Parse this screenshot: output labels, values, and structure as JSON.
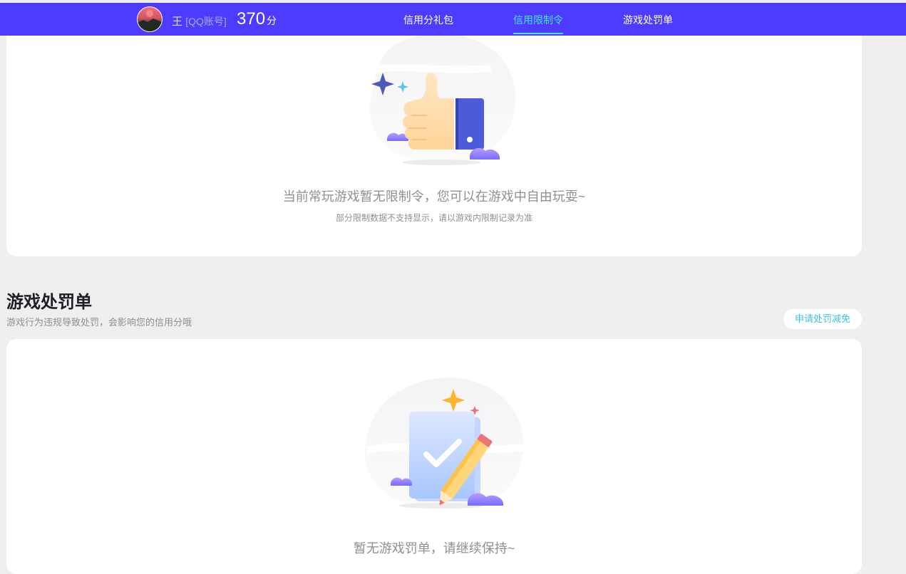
{
  "header": {
    "user_name": "王",
    "account_type": "[QQ账号]",
    "score": "370",
    "score_unit": "分",
    "nav": [
      {
        "label": "信用分礼包",
        "active": false
      },
      {
        "label": "信用限制令",
        "active": true
      },
      {
        "label": "游戏处罚单",
        "active": false
      }
    ]
  },
  "restriction": {
    "empty_title": "当前常玩游戏暂无限制令，您可以在游戏中自由玩耍~",
    "empty_note": "部分限制数据不支持显示，请以游戏内限制记录为准",
    "illustration_icon": "thumbs-up-icon"
  },
  "penalty": {
    "title": "游戏处罚单",
    "subtitle": "游戏行为违规导致处罚，会影响您的信用分哦",
    "appeal_label": "申请处罚减免",
    "empty_title": "暂无游戏罚单，请继续保持~",
    "illustration_icon": "checklist-pencil-icon"
  },
  "colors": {
    "topbar": "#4d3bff",
    "nav_active": "#43e6ff",
    "accent_link": "#3cc0e6"
  }
}
